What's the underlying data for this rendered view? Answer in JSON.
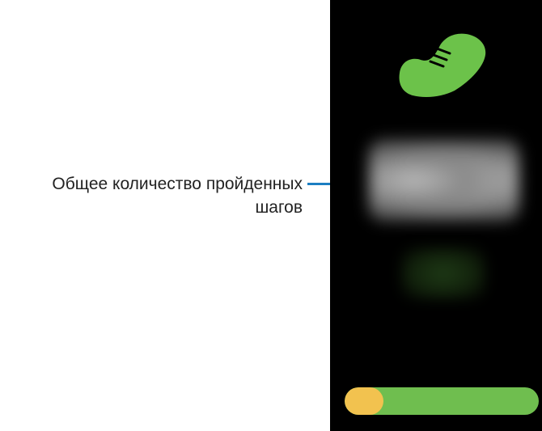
{
  "callout": {
    "label": "Общее количество пройденных шагов",
    "line_color": "#1b7ec2"
  },
  "screen": {
    "icon": "shoe-icon",
    "icon_color": "#6cc24a",
    "background_color": "#000000",
    "step_count_blurred": true,
    "goal_blurred": true
  },
  "progress": {
    "fraction": 0.2,
    "track_color": "#6fbe4f",
    "fill_color": "#f2c24f"
  }
}
